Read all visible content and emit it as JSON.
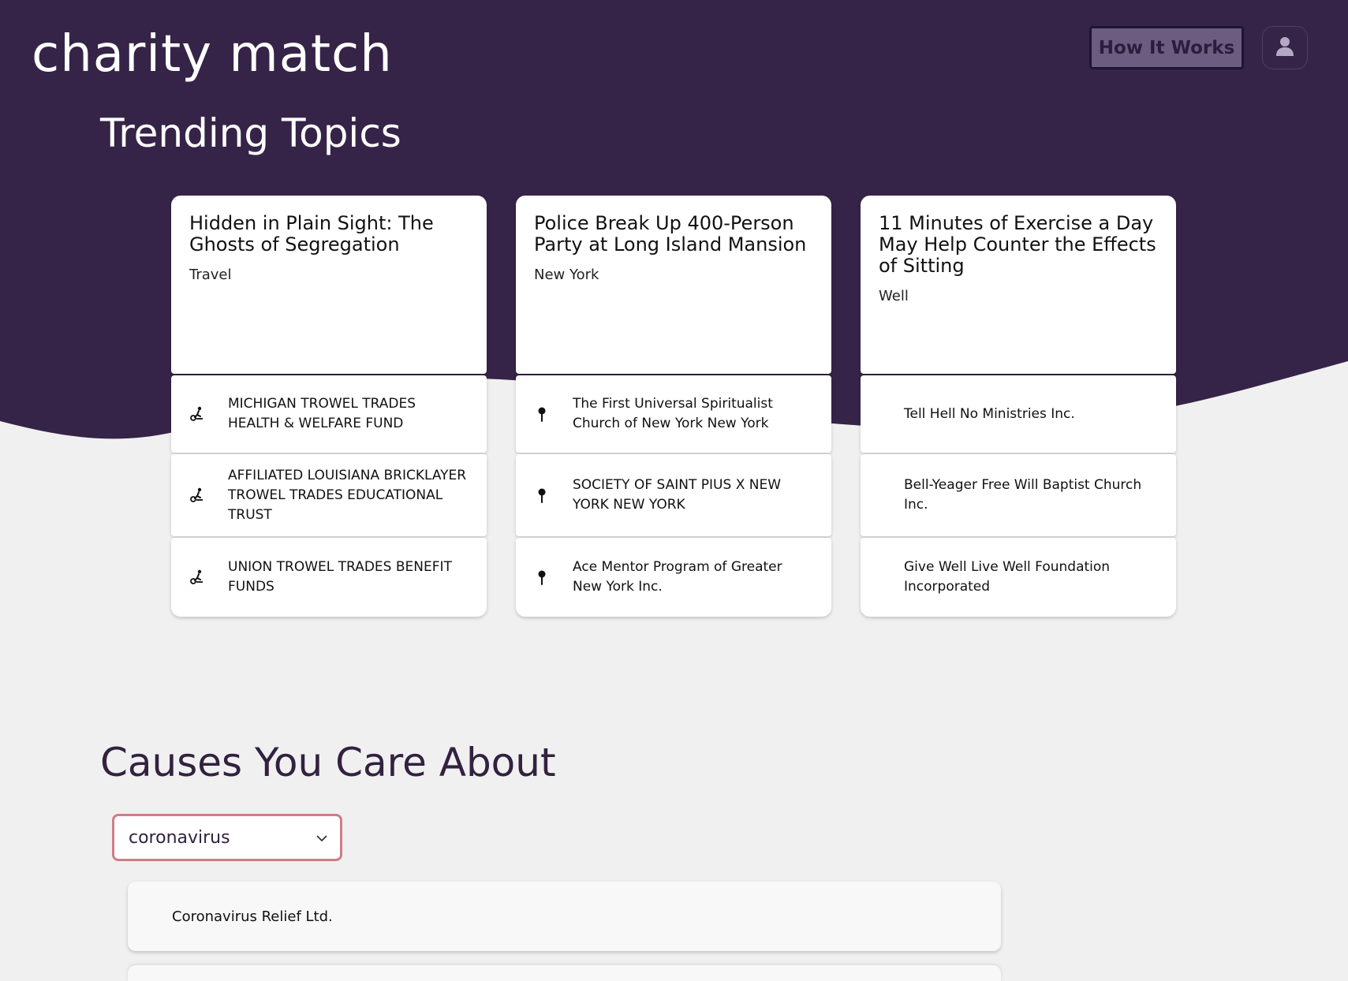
{
  "colors": {
    "header_bg": "#352447",
    "page_bg": "#f0f0f0",
    "accent_button": "#6b5c80",
    "select_border": "#cf7d86",
    "heading_dark": "#32213f"
  },
  "header": {
    "brand": "charity match",
    "how_it_works_label": "How It Works",
    "user_icon": "user-icon"
  },
  "trending": {
    "title": "Trending Topics",
    "cards": [
      {
        "title": "Hidden in Plain Sight: The Ghosts of Segregation",
        "category": "Travel",
        "icon": "hiking-icon",
        "orgs": [
          {
            "name": "MICHIGAN TROWEL TRADES HEALTH & WELFARE FUND"
          },
          {
            "name": "AFFILIATED LOUISIANA BRICKLAYER TROWEL TRADES EDUCATIONAL TRUST"
          },
          {
            "name": "UNION TROWEL TRADES BENEFIT FUNDS"
          }
        ]
      },
      {
        "title": "Police Break Up 400-Person Party at Long Island Mansion",
        "category": "New York",
        "icon": "map-pin-icon",
        "orgs": [
          {
            "name": "The First Universal Spiritualist Church of New York New York"
          },
          {
            "name": "SOCIETY OF SAINT PIUS X NEW YORK NEW YORK"
          },
          {
            "name": "Ace Mentor Program of Greater New York Inc."
          }
        ]
      },
      {
        "title": "11 Minutes of Exercise a Day May Help Counter the Effects of Sitting",
        "category": "Well",
        "orgs": [
          {
            "name": "Tell Hell No Ministries Inc."
          },
          {
            "name": "Bell-Yeager Free Will Baptist Church Inc."
          },
          {
            "name": "Give Well Live Well Foundation Incorporated"
          }
        ]
      }
    ]
  },
  "causes": {
    "title": "Causes You Care About",
    "selected": "coronavirus",
    "results": [
      {
        "name": "Coronavirus Relief Ltd."
      }
    ]
  }
}
